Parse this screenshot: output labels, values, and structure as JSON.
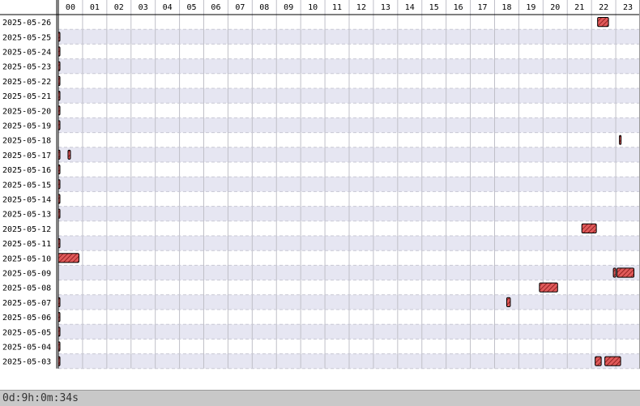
{
  "chart_data": {
    "type": "timeline",
    "hours": [
      "00",
      "01",
      "02",
      "03",
      "04",
      "05",
      "06",
      "07",
      "08",
      "09",
      "10",
      "11",
      "12",
      "13",
      "14",
      "15",
      "16",
      "17",
      "18",
      "19",
      "20",
      "21",
      "22",
      "23"
    ],
    "dates": [
      "2025-05-26",
      "2025-05-25",
      "2025-05-24",
      "2025-05-23",
      "2025-05-22",
      "2025-05-21",
      "2025-05-20",
      "2025-05-19",
      "2025-05-18",
      "2025-05-17",
      "2025-05-16",
      "2025-05-15",
      "2025-05-14",
      "2025-05-13",
      "2025-05-12",
      "2025-05-11",
      "2025-05-10",
      "2025-05-09",
      "2025-05-08",
      "2025-05-07",
      "2025-05-06",
      "2025-05-05",
      "2025-05-04",
      "2025-05-03"
    ],
    "series_color": "#e05a5a",
    "alt_row_color": "#e6e6f2",
    "grid": true,
    "sessions": [
      {
        "date": "2025-05-26",
        "start": 22.25,
        "end": 22.7
      },
      {
        "date": "2025-05-25",
        "start": 0.0,
        "end": 0.04
      },
      {
        "date": "2025-05-24",
        "start": 0.0,
        "end": 0.04
      },
      {
        "date": "2025-05-23",
        "start": 0.0,
        "end": 0.04
      },
      {
        "date": "2025-05-22",
        "start": 0.0,
        "end": 0.04
      },
      {
        "date": "2025-05-21",
        "start": 0.0,
        "end": 0.04
      },
      {
        "date": "2025-05-20",
        "start": 0.0,
        "end": 0.04
      },
      {
        "date": "2025-05-19",
        "start": 0.0,
        "end": 0.04
      },
      {
        "date": "2025-05-18",
        "start": 23.15,
        "end": 23.22
      },
      {
        "date": "2025-05-17",
        "start": 0.0,
        "end": 0.04
      },
      {
        "date": "2025-05-17",
        "start": 0.4,
        "end": 0.5
      },
      {
        "date": "2025-05-16",
        "start": 0.0,
        "end": 0.04
      },
      {
        "date": "2025-05-15",
        "start": 0.0,
        "end": 0.04
      },
      {
        "date": "2025-05-14",
        "start": 0.0,
        "end": 0.04
      },
      {
        "date": "2025-05-13",
        "start": 0.0,
        "end": 0.04
      },
      {
        "date": "2025-05-12",
        "start": 21.6,
        "end": 22.2
      },
      {
        "date": "2025-05-11",
        "start": 0.0,
        "end": 0.04
      },
      {
        "date": "2025-05-10",
        "start": 0.0,
        "end": 0.85
      },
      {
        "date": "2025-05-09",
        "start": 22.9,
        "end": 23.0
      },
      {
        "date": "2025-05-09",
        "start": 23.05,
        "end": 23.75
      },
      {
        "date": "2025-05-08",
        "start": 19.85,
        "end": 20.6
      },
      {
        "date": "2025-05-07",
        "start": 0.0,
        "end": 0.04
      },
      {
        "date": "2025-05-07",
        "start": 18.5,
        "end": 18.65
      },
      {
        "date": "2025-05-06",
        "start": 0.0,
        "end": 0.04
      },
      {
        "date": "2025-05-05",
        "start": 0.0,
        "end": 0.04
      },
      {
        "date": "2025-05-04",
        "start": 0.0,
        "end": 0.04
      },
      {
        "date": "2025-05-03",
        "start": 0.0,
        "end": 0.04
      },
      {
        "date": "2025-05-03",
        "start": 22.15,
        "end": 22.4
      },
      {
        "date": "2025-05-03",
        "start": 22.55,
        "end": 23.2
      }
    ]
  },
  "footer": {
    "total_duration": "0d:9h:0m:34s"
  }
}
